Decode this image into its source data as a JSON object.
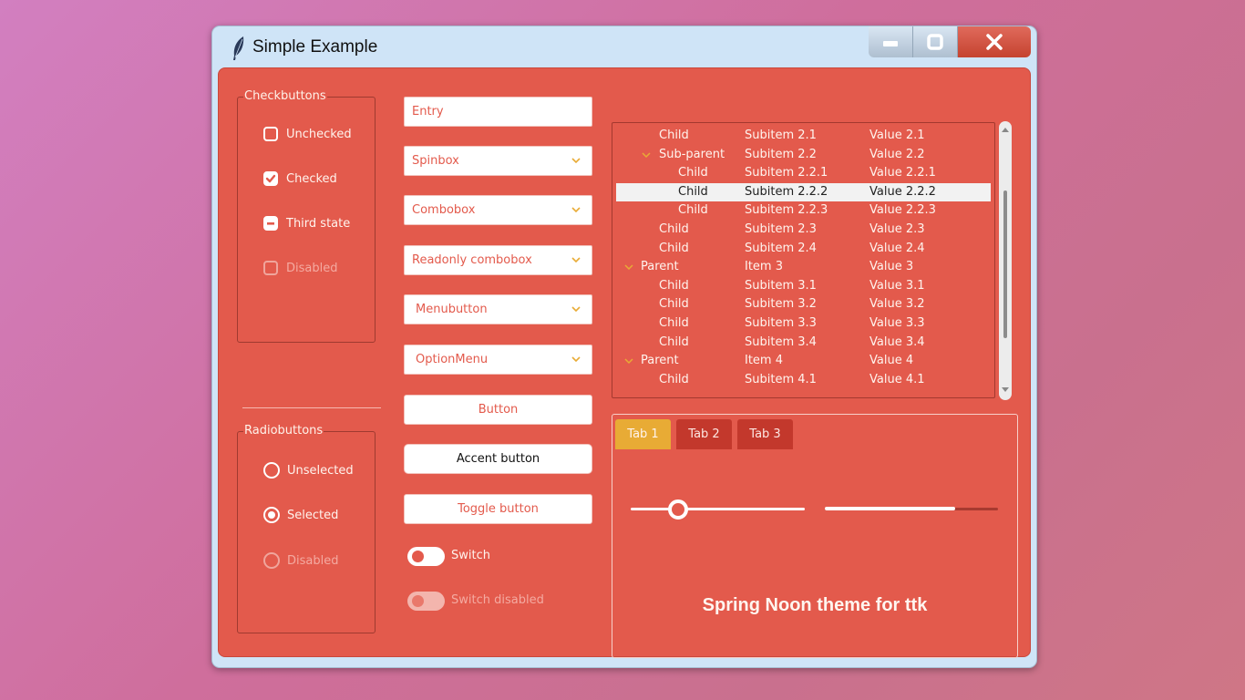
{
  "window": {
    "title": "Simple Example",
    "icon": "feather-icon"
  },
  "checkbuttons": {
    "title": "Checkbuttons",
    "items": [
      {
        "label": "Unchecked",
        "state": "unchecked"
      },
      {
        "label": "Checked",
        "state": "checked"
      },
      {
        "label": "Third state",
        "state": "indeterminate"
      },
      {
        "label": "Disabled",
        "state": "disabled"
      }
    ]
  },
  "radiobuttons": {
    "title": "Radiobuttons",
    "items": [
      {
        "label": "Unselected",
        "state": "unselected"
      },
      {
        "label": "Selected",
        "state": "selected"
      },
      {
        "label": "Disabled",
        "state": "disabled"
      }
    ]
  },
  "inputs": {
    "entry": "Entry",
    "spinbox": "Spinbox",
    "combobox": "Combobox",
    "readonly_combobox": "Readonly combobox",
    "menubutton": "Menubutton",
    "optionmenu": "OptionMenu"
  },
  "buttons": {
    "button": "Button",
    "accent": "Accent button",
    "toggle": "Toggle button"
  },
  "switches": {
    "switch": "Switch",
    "switch_disabled": "Switch disabled"
  },
  "tree": {
    "rows": [
      {
        "col0": "Child",
        "col1": "Subitem 2.1",
        "col2": "Value 2.1",
        "level": 2,
        "expandable": false
      },
      {
        "col0": "Sub-parent",
        "col1": "Subitem 2.2",
        "col2": "Value 2.2",
        "level": 1,
        "expandable": true
      },
      {
        "col0": "Child",
        "col1": "Subitem 2.2.1",
        "col2": "Value 2.2.1",
        "level": 3,
        "expandable": false
      },
      {
        "col0": "Child",
        "col1": "Subitem 2.2.2",
        "col2": "Value 2.2.2",
        "level": 3,
        "expandable": false,
        "selected": true
      },
      {
        "col0": "Child",
        "col1": "Subitem 2.2.3",
        "col2": "Value 2.2.3",
        "level": 3,
        "expandable": false
      },
      {
        "col0": "Child",
        "col1": "Subitem 2.3",
        "col2": "Value 2.3",
        "level": 2,
        "expandable": false
      },
      {
        "col0": "Child",
        "col1": "Subitem 2.4",
        "col2": "Value 2.4",
        "level": 2,
        "expandable": false
      },
      {
        "col0": "Parent",
        "col1": "Item 3",
        "col2": "Value 3",
        "level": 0,
        "expandable": true
      },
      {
        "col0": "Child",
        "col1": "Subitem 3.1",
        "col2": "Value 3.1",
        "level": 2,
        "expandable": false
      },
      {
        "col0": "Child",
        "col1": "Subitem 3.2",
        "col2": "Value 3.2",
        "level": 2,
        "expandable": false
      },
      {
        "col0": "Child",
        "col1": "Subitem 3.3",
        "col2": "Value 3.3",
        "level": 2,
        "expandable": false
      },
      {
        "col0": "Child",
        "col1": "Subitem 3.4",
        "col2": "Value 3.4",
        "level": 2,
        "expandable": false
      },
      {
        "col0": "Parent",
        "col1": "Item 4",
        "col2": "Value 4",
        "level": 0,
        "expandable": true
      },
      {
        "col0": "Child",
        "col1": "Subitem 4.1",
        "col2": "Value 4.1",
        "level": 2,
        "expandable": false
      }
    ]
  },
  "notebook": {
    "tabs": [
      "Tab 1",
      "Tab 2",
      "Tab 3"
    ],
    "active_tab": 0,
    "scale_value_fraction": 0.27,
    "progress_fraction": 0.75,
    "label": "Spring Noon theme for ttk"
  },
  "colors": {
    "accent": "#e35a4c",
    "tab_active": "#e8ab35",
    "title_bar": "#cfe4f7"
  }
}
